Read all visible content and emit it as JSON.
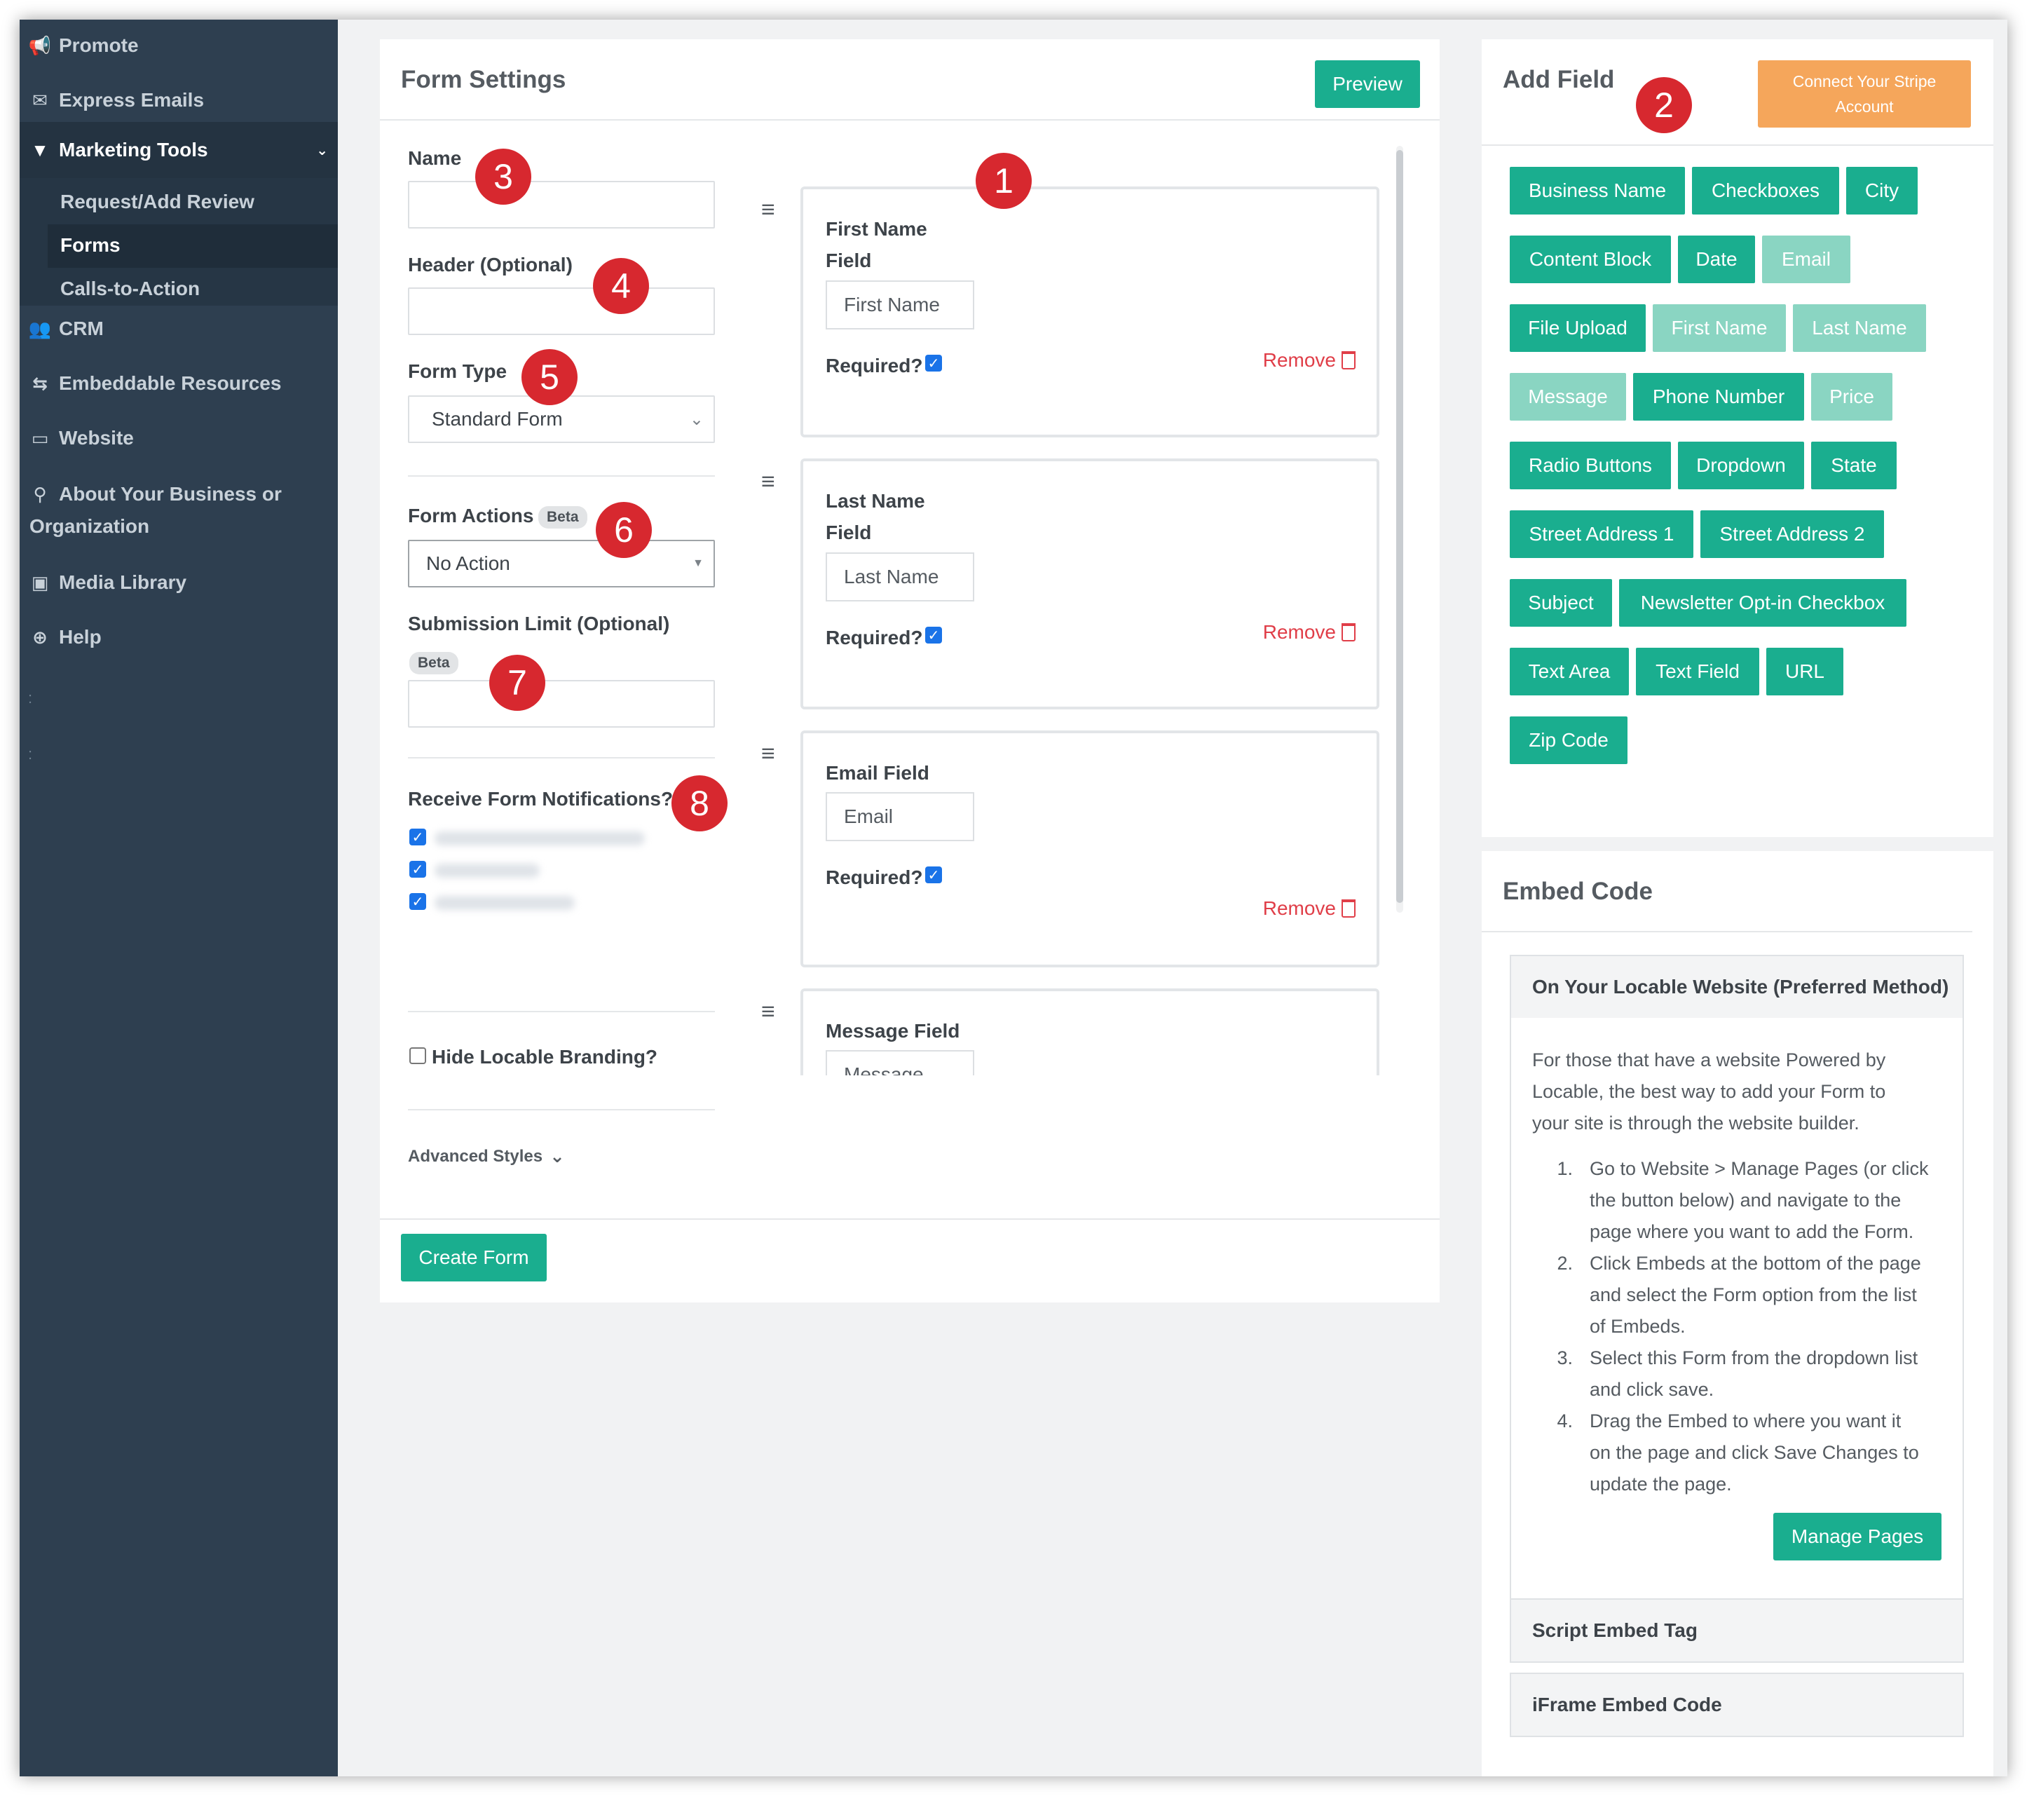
{
  "sidebar": {
    "items": [
      {
        "label": "Promote",
        "icon": "megaphone-icon"
      },
      {
        "label": "Express Emails",
        "icon": "envelope-icon"
      },
      {
        "label": "Marketing Tools",
        "icon": "filter-icon"
      },
      {
        "label": "CRM",
        "icon": "users-icon"
      },
      {
        "label": "Embeddable Resources",
        "icon": "signpost-icon"
      },
      {
        "label": "Website",
        "icon": "monitor-icon"
      },
      {
        "label": "About Your Business or",
        "label2": "Organization",
        "icon": "map-pin-icon"
      },
      {
        "label": "Media Library",
        "icon": "image-icon"
      },
      {
        "label": "Help",
        "icon": "lifebuoy-icon"
      }
    ],
    "submenu": [
      "Request/Add Review",
      "Forms",
      "Calls-to-Action"
    ],
    "current_sub": "Forms"
  },
  "form_settings": {
    "title": "Form Settings",
    "preview_label": "Preview",
    "name_label": "Name",
    "name_value": "",
    "header_label": "Header (Optional)",
    "header_value": "",
    "form_type_label": "Form Type",
    "form_type_value": "Standard Form",
    "form_actions_label": "Form Actions",
    "beta_label": "Beta",
    "form_actions_value": "No Action",
    "submission_limit_label": "Submission Limit (Optional)",
    "submission_limit_value": "",
    "notifications_label": "Receive Form Notifications?",
    "notifications_checked": [
      true,
      true,
      true
    ],
    "hide_branding_label": "Hide Locable Branding?",
    "hide_branding_checked": false,
    "advanced_styles_label": "Advanced Styles",
    "create_label": "Create Form"
  },
  "fields": [
    {
      "label_line1": "First Name",
      "label_line2": "Field",
      "placeholder": "First Name",
      "required_label": "Required?",
      "required": true,
      "remove_label": "Remove"
    },
    {
      "label_line1": "Last Name",
      "label_line2": "Field",
      "placeholder": "Last Name",
      "required_label": "Required?",
      "required": true,
      "remove_label": "Remove"
    },
    {
      "label_line1": "Email Field",
      "label_line2": "",
      "placeholder": "Email",
      "required_label": "Required?",
      "required": true,
      "remove_label": "Remove"
    },
    {
      "label_line1": "Message Field",
      "label_line2": "",
      "placeholder": "Message"
    }
  ],
  "add_field": {
    "title": "Add Field",
    "stripe_label_line1": "Connect Your Stripe",
    "stripe_label_line2": "Account",
    "chips": [
      {
        "label": "Business Name",
        "disabled": false
      },
      {
        "label": "Checkboxes",
        "disabled": false
      },
      {
        "label": "City",
        "disabled": false
      },
      {
        "label": "Content Block",
        "disabled": false
      },
      {
        "label": "Date",
        "disabled": false
      },
      {
        "label": "Email",
        "disabled": true
      },
      {
        "label": "File Upload",
        "disabled": false
      },
      {
        "label": "First Name",
        "disabled": true
      },
      {
        "label": "Last Name",
        "disabled": true
      },
      {
        "label": "Message",
        "disabled": true
      },
      {
        "label": "Phone Number",
        "disabled": false
      },
      {
        "label": "Price",
        "disabled": true
      },
      {
        "label": "Radio Buttons",
        "disabled": false
      },
      {
        "label": "Dropdown",
        "disabled": false
      },
      {
        "label": "State",
        "disabled": false
      },
      {
        "label": "Street Address 1",
        "disabled": false
      },
      {
        "label": "Street Address 2",
        "disabled": false
      },
      {
        "label": "Subject",
        "disabled": false
      },
      {
        "label": "Newsletter Opt-in Checkbox",
        "disabled": false
      },
      {
        "label": "Text Area",
        "disabled": false
      },
      {
        "label": "Text Field",
        "disabled": false
      },
      {
        "label": "URL",
        "disabled": false
      },
      {
        "label": "Zip Code",
        "disabled": false
      }
    ]
  },
  "embed": {
    "title": "Embed Code",
    "section1_title": "On Your Locable Website (Preferred Method)",
    "intro_lines": [
      "For those that have a website Powered by",
      "Locable, the best way to add your Form to",
      "your site is through the website builder."
    ],
    "steps": [
      {
        "num": "1.",
        "lines": [
          "Go to Website > Manage Pages (or click",
          "the button below) and navigate to the",
          "page where you want to add the Form."
        ]
      },
      {
        "num": "2.",
        "lines": [
          "Click Embeds at the bottom of the page",
          "and select the Form option from the list",
          "of Embeds."
        ]
      },
      {
        "num": "3.",
        "lines": [
          "Select this Form from the dropdown list",
          "and click save."
        ]
      },
      {
        "num": "4.",
        "lines": [
          "Drag the Embed to where you want it",
          "on the page and click Save Changes to",
          "update the page."
        ]
      }
    ],
    "manage_pages_label": "Manage Pages",
    "section2_title": "Script Embed Tag",
    "section3_title": "iFrame Embed Code"
  },
  "annotations": [
    "1",
    "2",
    "3",
    "4",
    "5",
    "6",
    "7",
    "8"
  ],
  "colors": {
    "sidebar": "#2e3f50",
    "accent": "#1aae8f",
    "accent_disabled": "#8ad5c2",
    "stripe": "#f5a65b",
    "badge": "#d7282f",
    "remove": "#e03e48"
  }
}
